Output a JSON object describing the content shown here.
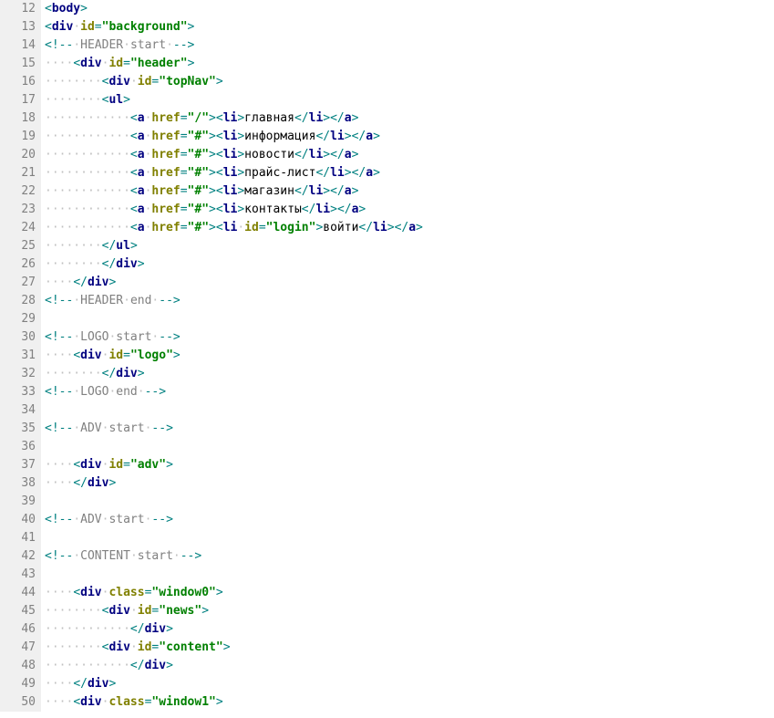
{
  "first_line_number": 12,
  "lines": [
    [
      {
        "cls": "tag-bracket",
        "t": "<"
      },
      {
        "cls": "tag-name",
        "t": "body"
      },
      {
        "cls": "tag-bracket",
        "t": ">"
      }
    ],
    [
      {
        "cls": "tag-bracket",
        "t": "<"
      },
      {
        "cls": "tag-name",
        "t": "div"
      },
      {
        "cls": "ws-dot",
        "t": "·"
      },
      {
        "cls": "attr-name",
        "t": "id"
      },
      {
        "cls": "tag-bracket",
        "t": "="
      },
      {
        "cls": "attr-value",
        "t": "\"background\""
      },
      {
        "cls": "tag-bracket",
        "t": ">"
      }
    ],
    [
      {
        "cls": "tag-bracket",
        "t": "<!--"
      },
      {
        "cls": "ws-dot",
        "t": "·"
      },
      {
        "cls": "comment",
        "t": "HEADER"
      },
      {
        "cls": "ws-dot",
        "t": "·"
      },
      {
        "cls": "comment",
        "t": "start"
      },
      {
        "cls": "ws-dot",
        "t": "·"
      },
      {
        "cls": "tag-bracket",
        "t": "-->"
      }
    ],
    [
      {
        "cls": "ws-dot",
        "t": "····"
      },
      {
        "cls": "tag-bracket",
        "t": "<"
      },
      {
        "cls": "tag-name",
        "t": "div"
      },
      {
        "cls": "ws-dot",
        "t": "·"
      },
      {
        "cls": "attr-name",
        "t": "id"
      },
      {
        "cls": "tag-bracket",
        "t": "="
      },
      {
        "cls": "attr-value",
        "t": "\"header\""
      },
      {
        "cls": "tag-bracket",
        "t": ">"
      }
    ],
    [
      {
        "cls": "ws-dot",
        "t": "········"
      },
      {
        "cls": "tag-bracket",
        "t": "<"
      },
      {
        "cls": "tag-name",
        "t": "div"
      },
      {
        "cls": "ws-dot",
        "t": "·"
      },
      {
        "cls": "attr-name",
        "t": "id"
      },
      {
        "cls": "tag-bracket",
        "t": "="
      },
      {
        "cls": "attr-value",
        "t": "\"topNav\""
      },
      {
        "cls": "tag-bracket",
        "t": ">"
      }
    ],
    [
      {
        "cls": "ws-dot",
        "t": "········"
      },
      {
        "cls": "tag-bracket",
        "t": "<"
      },
      {
        "cls": "tag-name",
        "t": "ul"
      },
      {
        "cls": "tag-bracket",
        "t": ">"
      }
    ],
    [
      {
        "cls": "ws-dot",
        "t": "············"
      },
      {
        "cls": "tag-bracket",
        "t": "<"
      },
      {
        "cls": "tag-name",
        "t": "a"
      },
      {
        "cls": "ws-dot",
        "t": "·"
      },
      {
        "cls": "attr-name",
        "t": "href"
      },
      {
        "cls": "tag-bracket",
        "t": "="
      },
      {
        "cls": "attr-value",
        "t": "\"/\""
      },
      {
        "cls": "tag-bracket",
        "t": ">"
      },
      {
        "cls": "tag-bracket",
        "t": "<"
      },
      {
        "cls": "tag-name",
        "t": "li"
      },
      {
        "cls": "tag-bracket",
        "t": ">"
      },
      {
        "cls": "txt",
        "t": "главная"
      },
      {
        "cls": "tag-bracket",
        "t": "</"
      },
      {
        "cls": "tag-name",
        "t": "li"
      },
      {
        "cls": "tag-bracket",
        "t": ">"
      },
      {
        "cls": "tag-bracket",
        "t": "</"
      },
      {
        "cls": "tag-name",
        "t": "a"
      },
      {
        "cls": "tag-bracket",
        "t": ">"
      }
    ],
    [
      {
        "cls": "ws-dot",
        "t": "············"
      },
      {
        "cls": "tag-bracket",
        "t": "<"
      },
      {
        "cls": "tag-name",
        "t": "a"
      },
      {
        "cls": "ws-dot",
        "t": "·"
      },
      {
        "cls": "attr-name",
        "t": "href"
      },
      {
        "cls": "tag-bracket",
        "t": "="
      },
      {
        "cls": "attr-value",
        "t": "\"#\""
      },
      {
        "cls": "tag-bracket",
        "t": ">"
      },
      {
        "cls": "tag-bracket",
        "t": "<"
      },
      {
        "cls": "tag-name",
        "t": "li"
      },
      {
        "cls": "tag-bracket",
        "t": ">"
      },
      {
        "cls": "txt",
        "t": "информация"
      },
      {
        "cls": "tag-bracket",
        "t": "</"
      },
      {
        "cls": "tag-name",
        "t": "li"
      },
      {
        "cls": "tag-bracket",
        "t": ">"
      },
      {
        "cls": "tag-bracket",
        "t": "</"
      },
      {
        "cls": "tag-name",
        "t": "a"
      },
      {
        "cls": "tag-bracket",
        "t": ">"
      }
    ],
    [
      {
        "cls": "ws-dot",
        "t": "············"
      },
      {
        "cls": "tag-bracket",
        "t": "<"
      },
      {
        "cls": "tag-name",
        "t": "a"
      },
      {
        "cls": "ws-dot",
        "t": "·"
      },
      {
        "cls": "attr-name",
        "t": "href"
      },
      {
        "cls": "tag-bracket",
        "t": "="
      },
      {
        "cls": "attr-value",
        "t": "\"#\""
      },
      {
        "cls": "tag-bracket",
        "t": ">"
      },
      {
        "cls": "tag-bracket",
        "t": "<"
      },
      {
        "cls": "tag-name",
        "t": "li"
      },
      {
        "cls": "tag-bracket",
        "t": ">"
      },
      {
        "cls": "txt",
        "t": "новости"
      },
      {
        "cls": "tag-bracket",
        "t": "</"
      },
      {
        "cls": "tag-name",
        "t": "li"
      },
      {
        "cls": "tag-bracket",
        "t": ">"
      },
      {
        "cls": "tag-bracket",
        "t": "</"
      },
      {
        "cls": "tag-name",
        "t": "a"
      },
      {
        "cls": "tag-bracket",
        "t": ">"
      }
    ],
    [
      {
        "cls": "ws-dot",
        "t": "············"
      },
      {
        "cls": "tag-bracket",
        "t": "<"
      },
      {
        "cls": "tag-name",
        "t": "a"
      },
      {
        "cls": "ws-dot",
        "t": "·"
      },
      {
        "cls": "attr-name",
        "t": "href"
      },
      {
        "cls": "tag-bracket",
        "t": "="
      },
      {
        "cls": "attr-value",
        "t": "\"#\""
      },
      {
        "cls": "tag-bracket",
        "t": ">"
      },
      {
        "cls": "tag-bracket",
        "t": "<"
      },
      {
        "cls": "tag-name",
        "t": "li"
      },
      {
        "cls": "tag-bracket",
        "t": ">"
      },
      {
        "cls": "txt",
        "t": "прайс-лист"
      },
      {
        "cls": "tag-bracket",
        "t": "</"
      },
      {
        "cls": "tag-name",
        "t": "li"
      },
      {
        "cls": "tag-bracket",
        "t": ">"
      },
      {
        "cls": "tag-bracket",
        "t": "</"
      },
      {
        "cls": "tag-name",
        "t": "a"
      },
      {
        "cls": "tag-bracket",
        "t": ">"
      }
    ],
    [
      {
        "cls": "ws-dot",
        "t": "············"
      },
      {
        "cls": "tag-bracket",
        "t": "<"
      },
      {
        "cls": "tag-name",
        "t": "a"
      },
      {
        "cls": "ws-dot",
        "t": "·"
      },
      {
        "cls": "attr-name",
        "t": "href"
      },
      {
        "cls": "tag-bracket",
        "t": "="
      },
      {
        "cls": "attr-value",
        "t": "\"#\""
      },
      {
        "cls": "tag-bracket",
        "t": ">"
      },
      {
        "cls": "tag-bracket",
        "t": "<"
      },
      {
        "cls": "tag-name",
        "t": "li"
      },
      {
        "cls": "tag-bracket",
        "t": ">"
      },
      {
        "cls": "txt",
        "t": "магазин"
      },
      {
        "cls": "tag-bracket",
        "t": "</"
      },
      {
        "cls": "tag-name",
        "t": "li"
      },
      {
        "cls": "tag-bracket",
        "t": ">"
      },
      {
        "cls": "tag-bracket",
        "t": "</"
      },
      {
        "cls": "tag-name",
        "t": "a"
      },
      {
        "cls": "tag-bracket",
        "t": ">"
      }
    ],
    [
      {
        "cls": "ws-dot",
        "t": "············"
      },
      {
        "cls": "tag-bracket",
        "t": "<"
      },
      {
        "cls": "tag-name",
        "t": "a"
      },
      {
        "cls": "ws-dot",
        "t": "·"
      },
      {
        "cls": "attr-name",
        "t": "href"
      },
      {
        "cls": "tag-bracket",
        "t": "="
      },
      {
        "cls": "attr-value",
        "t": "\"#\""
      },
      {
        "cls": "tag-bracket",
        "t": ">"
      },
      {
        "cls": "tag-bracket",
        "t": "<"
      },
      {
        "cls": "tag-name",
        "t": "li"
      },
      {
        "cls": "tag-bracket",
        "t": ">"
      },
      {
        "cls": "txt",
        "t": "контакты"
      },
      {
        "cls": "tag-bracket",
        "t": "</"
      },
      {
        "cls": "tag-name",
        "t": "li"
      },
      {
        "cls": "tag-bracket",
        "t": ">"
      },
      {
        "cls": "tag-bracket",
        "t": "</"
      },
      {
        "cls": "tag-name",
        "t": "a"
      },
      {
        "cls": "tag-bracket",
        "t": ">"
      }
    ],
    [
      {
        "cls": "ws-dot",
        "t": "············"
      },
      {
        "cls": "tag-bracket",
        "t": "<"
      },
      {
        "cls": "tag-name",
        "t": "a"
      },
      {
        "cls": "ws-dot",
        "t": "·"
      },
      {
        "cls": "attr-name",
        "t": "href"
      },
      {
        "cls": "tag-bracket",
        "t": "="
      },
      {
        "cls": "attr-value",
        "t": "\"#\""
      },
      {
        "cls": "tag-bracket",
        "t": ">"
      },
      {
        "cls": "tag-bracket",
        "t": "<"
      },
      {
        "cls": "tag-name",
        "t": "li"
      },
      {
        "cls": "ws-dot",
        "t": "·"
      },
      {
        "cls": "attr-name",
        "t": "id"
      },
      {
        "cls": "tag-bracket",
        "t": "="
      },
      {
        "cls": "attr-value",
        "t": "\"login\""
      },
      {
        "cls": "tag-bracket",
        "t": ">"
      },
      {
        "cls": "txt",
        "t": "войти"
      },
      {
        "cls": "tag-bracket",
        "t": "</"
      },
      {
        "cls": "tag-name",
        "t": "li"
      },
      {
        "cls": "tag-bracket",
        "t": ">"
      },
      {
        "cls": "tag-bracket",
        "t": "</"
      },
      {
        "cls": "tag-name",
        "t": "a"
      },
      {
        "cls": "tag-bracket",
        "t": ">"
      }
    ],
    [
      {
        "cls": "ws-dot",
        "t": "········"
      },
      {
        "cls": "tag-bracket",
        "t": "</"
      },
      {
        "cls": "tag-name",
        "t": "ul"
      },
      {
        "cls": "tag-bracket",
        "t": ">"
      }
    ],
    [
      {
        "cls": "ws-dot",
        "t": "········"
      },
      {
        "cls": "tag-bracket",
        "t": "</"
      },
      {
        "cls": "tag-name",
        "t": "div"
      },
      {
        "cls": "tag-bracket",
        "t": ">"
      }
    ],
    [
      {
        "cls": "ws-dot",
        "t": "····"
      },
      {
        "cls": "tag-bracket",
        "t": "</"
      },
      {
        "cls": "tag-name",
        "t": "div"
      },
      {
        "cls": "tag-bracket",
        "t": ">"
      }
    ],
    [
      {
        "cls": "tag-bracket",
        "t": "<!--"
      },
      {
        "cls": "ws-dot",
        "t": "·"
      },
      {
        "cls": "comment",
        "t": "HEADER"
      },
      {
        "cls": "ws-dot",
        "t": "·"
      },
      {
        "cls": "comment",
        "t": "end"
      },
      {
        "cls": "ws-dot",
        "t": "·"
      },
      {
        "cls": "tag-bracket",
        "t": "-->"
      }
    ],
    [],
    [
      {
        "cls": "tag-bracket",
        "t": "<!--"
      },
      {
        "cls": "ws-dot",
        "t": "·"
      },
      {
        "cls": "comment",
        "t": "LOGO"
      },
      {
        "cls": "ws-dot",
        "t": "·"
      },
      {
        "cls": "comment",
        "t": "start"
      },
      {
        "cls": "ws-dot",
        "t": "·"
      },
      {
        "cls": "tag-bracket",
        "t": "-->"
      }
    ],
    [
      {
        "cls": "ws-dot",
        "t": "····"
      },
      {
        "cls": "tag-bracket",
        "t": "<"
      },
      {
        "cls": "tag-name",
        "t": "div"
      },
      {
        "cls": "ws-dot",
        "t": "·"
      },
      {
        "cls": "attr-name",
        "t": "id"
      },
      {
        "cls": "tag-bracket",
        "t": "="
      },
      {
        "cls": "attr-value",
        "t": "\"logo\""
      },
      {
        "cls": "tag-bracket",
        "t": ">"
      }
    ],
    [
      {
        "cls": "ws-dot",
        "t": "········"
      },
      {
        "cls": "tag-bracket",
        "t": "</"
      },
      {
        "cls": "tag-name",
        "t": "div"
      },
      {
        "cls": "tag-bracket",
        "t": ">"
      }
    ],
    [
      {
        "cls": "tag-bracket",
        "t": "<!--"
      },
      {
        "cls": "ws-dot",
        "t": "·"
      },
      {
        "cls": "comment",
        "t": "LOGO"
      },
      {
        "cls": "ws-dot",
        "t": "·"
      },
      {
        "cls": "comment",
        "t": "end"
      },
      {
        "cls": "ws-dot",
        "t": "·"
      },
      {
        "cls": "tag-bracket",
        "t": "-->"
      }
    ],
    [],
    [
      {
        "cls": "tag-bracket",
        "t": "<!--"
      },
      {
        "cls": "ws-dot",
        "t": "·"
      },
      {
        "cls": "comment",
        "t": "ADV"
      },
      {
        "cls": "ws-dot",
        "t": "·"
      },
      {
        "cls": "comment",
        "t": "start"
      },
      {
        "cls": "ws-dot",
        "t": "·"
      },
      {
        "cls": "tag-bracket",
        "t": "-->"
      }
    ],
    [],
    [
      {
        "cls": "ws-dot",
        "t": "····"
      },
      {
        "cls": "tag-bracket",
        "t": "<"
      },
      {
        "cls": "tag-name",
        "t": "div"
      },
      {
        "cls": "ws-dot",
        "t": "·"
      },
      {
        "cls": "attr-name",
        "t": "id"
      },
      {
        "cls": "tag-bracket",
        "t": "="
      },
      {
        "cls": "attr-value",
        "t": "\"adv\""
      },
      {
        "cls": "tag-bracket",
        "t": ">"
      }
    ],
    [
      {
        "cls": "ws-dot",
        "t": "····"
      },
      {
        "cls": "tag-bracket",
        "t": "</"
      },
      {
        "cls": "tag-name",
        "t": "div"
      },
      {
        "cls": "tag-bracket",
        "t": ">"
      }
    ],
    [],
    [
      {
        "cls": "tag-bracket",
        "t": "<!--"
      },
      {
        "cls": "ws-dot",
        "t": "·"
      },
      {
        "cls": "comment",
        "t": "ADV"
      },
      {
        "cls": "ws-dot",
        "t": "·"
      },
      {
        "cls": "comment",
        "t": "start"
      },
      {
        "cls": "ws-dot",
        "t": "·"
      },
      {
        "cls": "tag-bracket",
        "t": "-->"
      }
    ],
    [],
    [
      {
        "cls": "tag-bracket",
        "t": "<!--"
      },
      {
        "cls": "ws-dot",
        "t": "·"
      },
      {
        "cls": "comment",
        "t": "CONTENT"
      },
      {
        "cls": "ws-dot",
        "t": "·"
      },
      {
        "cls": "comment",
        "t": "start"
      },
      {
        "cls": "ws-dot",
        "t": "·"
      },
      {
        "cls": "tag-bracket",
        "t": "-->"
      }
    ],
    [],
    [
      {
        "cls": "ws-dot",
        "t": "····"
      },
      {
        "cls": "tag-bracket",
        "t": "<"
      },
      {
        "cls": "tag-name",
        "t": "div"
      },
      {
        "cls": "ws-dot",
        "t": "·"
      },
      {
        "cls": "attr-name",
        "t": "class"
      },
      {
        "cls": "tag-bracket",
        "t": "="
      },
      {
        "cls": "attr-value",
        "t": "\"window0\""
      },
      {
        "cls": "tag-bracket",
        "t": ">"
      }
    ],
    [
      {
        "cls": "ws-dot",
        "t": "········"
      },
      {
        "cls": "tag-bracket",
        "t": "<"
      },
      {
        "cls": "tag-name",
        "t": "div"
      },
      {
        "cls": "ws-dot",
        "t": "·"
      },
      {
        "cls": "attr-name",
        "t": "id"
      },
      {
        "cls": "tag-bracket",
        "t": "="
      },
      {
        "cls": "attr-value",
        "t": "\"news\""
      },
      {
        "cls": "tag-bracket",
        "t": ">"
      }
    ],
    [
      {
        "cls": "ws-dot",
        "t": "············"
      },
      {
        "cls": "tag-bracket",
        "t": "</"
      },
      {
        "cls": "tag-name",
        "t": "div"
      },
      {
        "cls": "tag-bracket",
        "t": ">"
      }
    ],
    [
      {
        "cls": "ws-dot",
        "t": "········"
      },
      {
        "cls": "tag-bracket",
        "t": "<"
      },
      {
        "cls": "tag-name",
        "t": "div"
      },
      {
        "cls": "ws-dot",
        "t": "·"
      },
      {
        "cls": "attr-name",
        "t": "id"
      },
      {
        "cls": "tag-bracket",
        "t": "="
      },
      {
        "cls": "attr-value",
        "t": "\"content\""
      },
      {
        "cls": "tag-bracket",
        "t": ">"
      }
    ],
    [
      {
        "cls": "ws-dot",
        "t": "············"
      },
      {
        "cls": "tag-bracket",
        "t": "</"
      },
      {
        "cls": "tag-name",
        "t": "div"
      },
      {
        "cls": "tag-bracket",
        "t": ">"
      }
    ],
    [
      {
        "cls": "ws-dot",
        "t": "····"
      },
      {
        "cls": "tag-bracket",
        "t": "</"
      },
      {
        "cls": "tag-name",
        "t": "div"
      },
      {
        "cls": "tag-bracket",
        "t": ">"
      }
    ],
    [
      {
        "cls": "ws-dot",
        "t": "····"
      },
      {
        "cls": "tag-bracket",
        "t": "<"
      },
      {
        "cls": "tag-name",
        "t": "div"
      },
      {
        "cls": "ws-dot",
        "t": "·"
      },
      {
        "cls": "attr-name",
        "t": "class"
      },
      {
        "cls": "tag-bracket",
        "t": "="
      },
      {
        "cls": "attr-value",
        "t": "\"window1\""
      },
      {
        "cls": "tag-bracket",
        "t": ">"
      }
    ]
  ]
}
